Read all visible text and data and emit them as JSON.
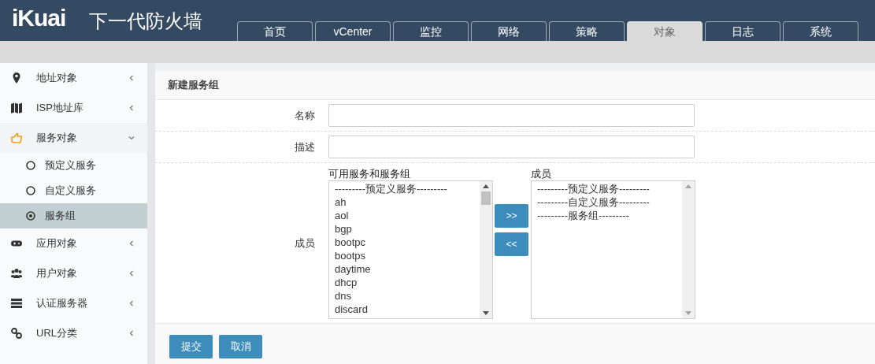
{
  "header": {
    "logo": "iKuai",
    "title": "下一代防火墙"
  },
  "tabs": [
    {
      "label": "首页",
      "selected": false
    },
    {
      "label": "vCenter",
      "selected": false
    },
    {
      "label": "监控",
      "selected": false
    },
    {
      "label": "网络",
      "selected": false
    },
    {
      "label": "策略",
      "selected": false
    },
    {
      "label": "对象",
      "selected": true
    },
    {
      "label": "日志",
      "selected": false
    },
    {
      "label": "系统",
      "selected": false
    }
  ],
  "sidebar": {
    "items": [
      {
        "label": "地址对象",
        "expanded": false
      },
      {
        "label": "ISP地址库",
        "expanded": false
      },
      {
        "label": "服务对象",
        "expanded": true,
        "children": [
          {
            "label": "预定义服务",
            "selected": false
          },
          {
            "label": "自定义服务",
            "selected": false
          },
          {
            "label": "服务组",
            "selected": true
          }
        ]
      },
      {
        "label": "应用对象",
        "expanded": false
      },
      {
        "label": "用户对象",
        "expanded": false
      },
      {
        "label": "认证服务器",
        "expanded": false
      },
      {
        "label": "URL分类",
        "expanded": false
      }
    ]
  },
  "form": {
    "title": "新建服务组",
    "fields": [
      {
        "label": "名称",
        "kind": "text"
      },
      {
        "label": "描述",
        "kind": "text"
      },
      {
        "label": "成员",
        "kind": "dual",
        "available": {
          "label": "可用服务和服务组",
          "options": [
            "---------预定义服务---------",
            "ah",
            "aol",
            "bgp",
            "bootpc",
            "bootps",
            "daytime",
            "dhcp",
            "dns",
            "discard"
          ]
        },
        "add": ">>",
        "remove": "<<",
        "members": {
          "label": "成员",
          "options": [
            "---------预定义服务---------",
            "---------自定义服务---------",
            "---------服务组---------"
          ]
        }
      }
    ],
    "buttons": [
      "提交",
      "取消"
    ]
  }
}
